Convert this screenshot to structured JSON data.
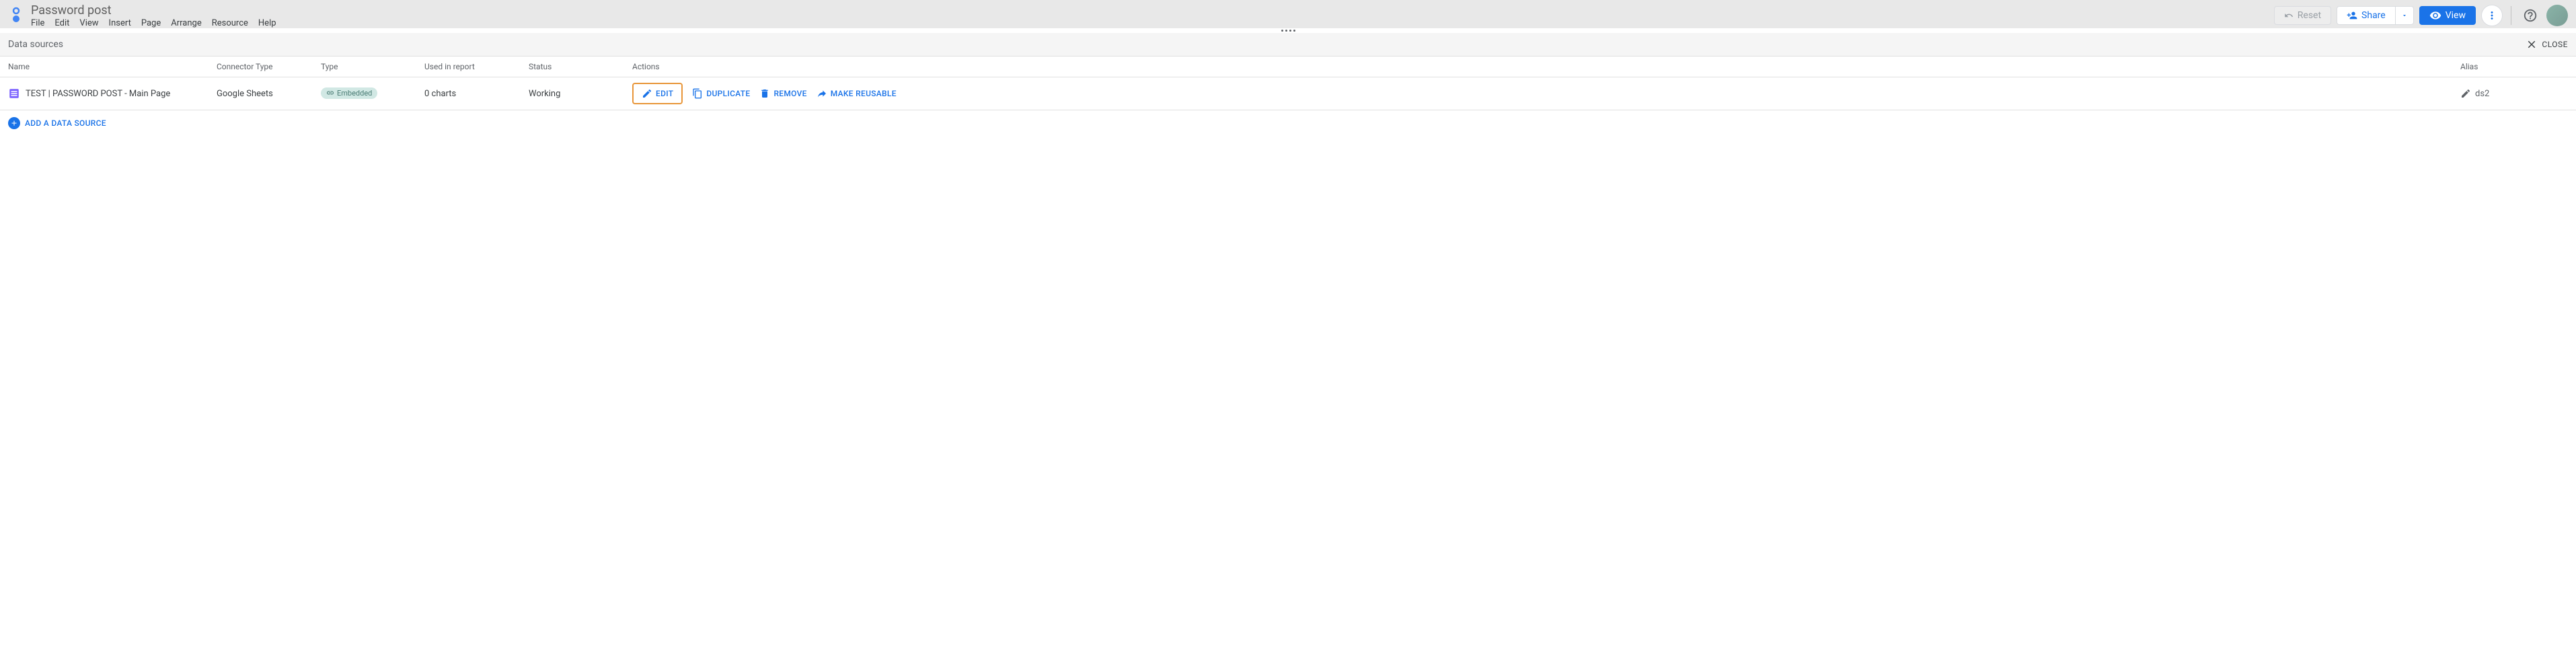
{
  "header": {
    "title": "Password post",
    "menu": {
      "file": "File",
      "edit": "Edit",
      "view": "View",
      "insert": "Insert",
      "page": "Page",
      "arrange": "Arrange",
      "resource": "Resource",
      "help": "Help"
    },
    "buttons": {
      "reset": "Reset",
      "share": "Share",
      "view": "View"
    }
  },
  "subheader": {
    "title": "Data sources",
    "close": "CLOSE"
  },
  "table": {
    "headers": {
      "name": "Name",
      "connector": "Connector Type",
      "type": "Type",
      "used": "Used in report",
      "status": "Status",
      "actions": "Actions",
      "alias": "Alias"
    },
    "rows": [
      {
        "name": "TEST | PASSWORD POST - Main Page",
        "connector": "Google Sheets",
        "type_label": "Embedded",
        "used": "0 charts",
        "status": "Working",
        "alias": "ds2"
      }
    ],
    "actions": {
      "edit": "EDIT",
      "duplicate": "DUPLICATE",
      "remove": "REMOVE",
      "make_reusable": "MAKE REUSABLE"
    }
  },
  "add_source": "ADD A DATA SOURCE"
}
